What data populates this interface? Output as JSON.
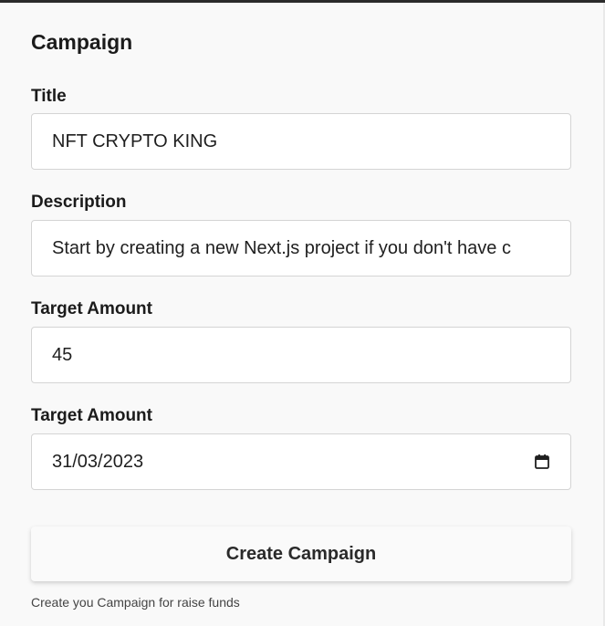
{
  "form": {
    "heading": "Campaign",
    "fields": [
      {
        "label": "Title",
        "value": "NFT CRYPTO KING"
      },
      {
        "label": "Description",
        "value": "Start by creating a new Next.js project if you don't have c"
      },
      {
        "label": "Target Amount",
        "value": "45"
      },
      {
        "label": "Target Amount",
        "value": "31/03/2023",
        "icon": "calendar-icon"
      }
    ],
    "submit_label": "Create Campaign",
    "helper_text": "Create you Campaign for raise funds"
  },
  "colors": {
    "background": "#f9f9f9",
    "input_background": "#ffffff",
    "input_border": "#d4d4d4",
    "text": "#1b1b1b"
  }
}
